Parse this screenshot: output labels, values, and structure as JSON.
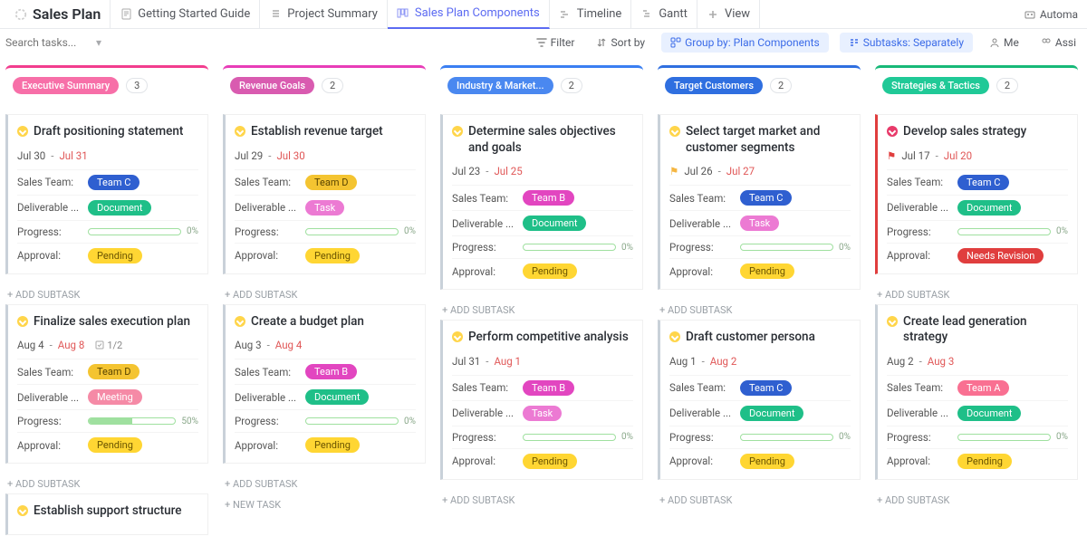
{
  "header": {
    "title": "Sales Plan",
    "tabs": [
      {
        "icon": "doc",
        "label": "Getting Started Guide"
      },
      {
        "icon": "list",
        "label": "Project Summary"
      },
      {
        "icon": "board",
        "label": "Sales Plan Components",
        "active": true
      },
      {
        "icon": "timeline",
        "label": "Timeline"
      },
      {
        "icon": "gantt",
        "label": "Gantt"
      },
      {
        "icon": "plus",
        "label": "View"
      }
    ],
    "automate": "Automa"
  },
  "toolbar": {
    "search_placeholder": "Search tasks...",
    "filter": "Filter",
    "sort": "Sort by",
    "groupby": "Group by: Plan Components",
    "subtasks": "Subtasks: Separately",
    "me": "Me",
    "assignees": "Assi"
  },
  "labels": {
    "sales_team": "Sales Team:",
    "deliverable": "Deliverable ...",
    "progress": "Progress:",
    "approval": "Approval:",
    "add_subtask": "+ ADD SUBTASK",
    "new_task": "+ NEW TASK"
  },
  "columns": [
    {
      "name": "Executive Summary",
      "count": "3",
      "pill_class": "pill-pink",
      "cards": [
        {
          "title": "Draft positioning statement",
          "from": "Jul 30",
          "to": "Jul 31",
          "team": "Team C",
          "team_class": "tc-c",
          "deliv": "Document",
          "deliv_class": "dv-doc",
          "progress": 0,
          "approval": "Pending",
          "approval_class": "ap-pending"
        },
        {
          "title": "Finalize sales execution plan",
          "from": "Aug 4",
          "to": "Aug 8",
          "checklist": "1/2",
          "team": "Team D",
          "team_class": "tc-d",
          "deliv": "Meeting",
          "deliv_class": "dv-meet",
          "progress": 50,
          "approval": "Pending",
          "approval_class": "ap-pending"
        },
        {
          "title": "Establish support structure",
          "partial": true
        }
      ]
    },
    {
      "name": "Revenue Goals",
      "count": "2",
      "pill_class": "pill-magenta",
      "cards": [
        {
          "title": "Establish revenue target",
          "from": "Jul 29",
          "to": "Jul 30",
          "team": "Team D",
          "team_class": "tc-d",
          "deliv": "Task",
          "deliv_class": "dv-task",
          "progress": 0,
          "approval": "Pending",
          "approval_class": "ap-pending"
        },
        {
          "title": "Create a budget plan",
          "from": "Aug 3",
          "to": "Aug 4",
          "team": "Team B",
          "team_class": "tc-b",
          "deliv": "Document",
          "deliv_class": "dv-doc",
          "progress": 0,
          "approval": "Pending",
          "approval_class": "ap-pending"
        }
      ],
      "newtask": true
    },
    {
      "name": "Industry & Market...",
      "count": "2",
      "pill_class": "pill-blue",
      "cards": [
        {
          "title": "Determine sales objectives and goals",
          "from": "Jul 23",
          "to": "Jul 25",
          "team": "Team B",
          "team_class": "tc-b",
          "deliv": "Document",
          "deliv_class": "dv-doc",
          "progress": 0,
          "approval": "Pending",
          "approval_class": "ap-pending"
        },
        {
          "title": "Perform competitive analysis",
          "from": "Jul 31",
          "to": "Aug 1",
          "team": "Team B",
          "team_class": "tc-b",
          "deliv": "Task",
          "deliv_class": "dv-task",
          "progress": 0,
          "approval": "Pending",
          "approval_class": "ap-pending"
        }
      ]
    },
    {
      "name": "Target Customers",
      "count": "2",
      "pill_class": "pill-dblue",
      "cards": [
        {
          "title": "Select target market and customer segments",
          "from": "Jul 26",
          "to": "Jul 27",
          "flag": "yellow",
          "team": "Team C",
          "team_class": "tc-c",
          "deliv": "Task",
          "deliv_class": "dv-task",
          "progress": 0,
          "approval": "Pending",
          "approval_class": "ap-pending"
        },
        {
          "title": "Draft customer persona",
          "from": "Aug 1",
          "to": "Aug 2",
          "team": "Team C",
          "team_class": "tc-c",
          "deliv": "Document",
          "deliv_class": "dv-doc",
          "progress": 0,
          "approval": "Pending",
          "approval_class": "ap-pending"
        }
      ]
    },
    {
      "name": "Strategies & Tactics",
      "count": "2",
      "pill_class": "pill-green",
      "cards": [
        {
          "title": "Develop sales strategy",
          "urgent": true,
          "from": "Jul 17",
          "to": "Jul 20",
          "flag": "red",
          "team": "Team C",
          "team_class": "tc-c",
          "deliv": "Document",
          "deliv_class": "dv-doc",
          "progress": 0,
          "approval": "Needs Revision",
          "approval_class": "ap-need",
          "red_border": true
        },
        {
          "title": "Create lead generation strategy",
          "from": "Aug 2",
          "to": "Aug 3",
          "team": "Team A",
          "team_class": "tc-a",
          "deliv": "Document",
          "deliv_class": "dv-doc",
          "progress": 0,
          "approval": "Pending",
          "approval_class": "ap-pending"
        }
      ]
    }
  ]
}
